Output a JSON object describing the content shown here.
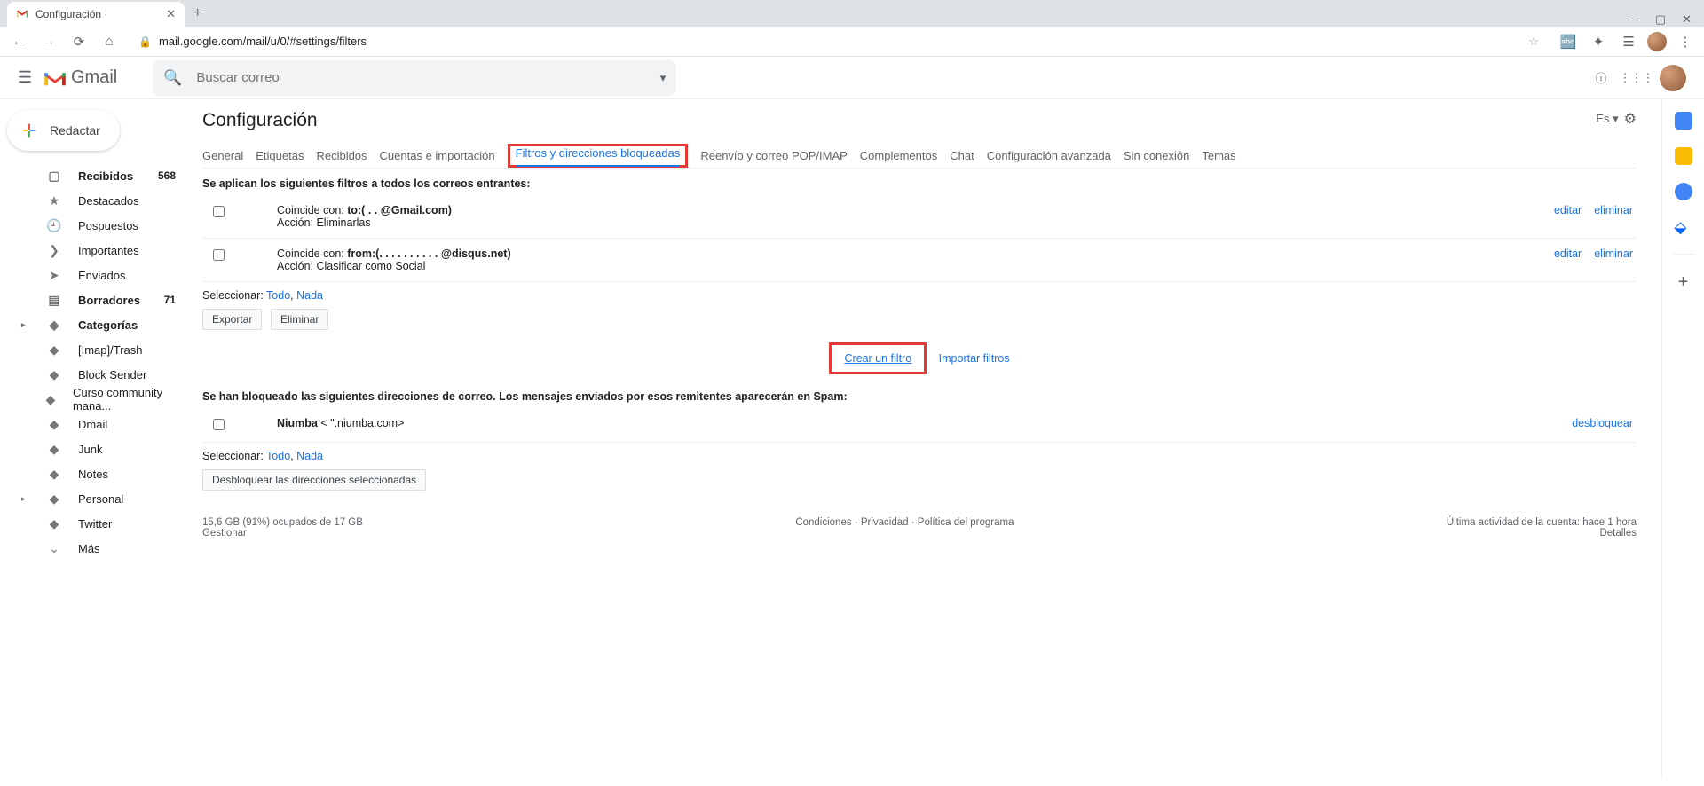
{
  "browser": {
    "tab_title": "Configuración ·",
    "url": "mail.google.com/mail/u/0/#settings/filters"
  },
  "header": {
    "logo_text": "Gmail",
    "search_placeholder": "Buscar correo"
  },
  "compose_label": "Redactar",
  "sidebar": {
    "items": [
      {
        "label": "Recibidos",
        "count": "568",
        "bold": true,
        "icon": "▢"
      },
      {
        "label": "Destacados",
        "icon": "★"
      },
      {
        "label": "Pospuestos",
        "icon": "🕘"
      },
      {
        "label": "Importantes",
        "icon": "❯"
      },
      {
        "label": "Enviados",
        "icon": "➤"
      },
      {
        "label": "Borradores",
        "count": "71",
        "bold": true,
        "icon": "▤"
      },
      {
        "label": "Categorías",
        "bold": true,
        "expandable": true,
        "icon": "◆"
      },
      {
        "label": "[Imap]/Trash",
        "icon": "◆"
      },
      {
        "label": "Block Sender",
        "icon": "◆"
      },
      {
        "label": "Curso community mana...",
        "icon": "◆"
      },
      {
        "label": "Dmail",
        "icon": "◆"
      },
      {
        "label": "Junk",
        "icon": "◆"
      },
      {
        "label": "Notes",
        "icon": "◆"
      },
      {
        "label": "Personal",
        "expandable": true,
        "icon": "◆"
      },
      {
        "label": "Twitter",
        "icon": "◆"
      },
      {
        "label": "Más",
        "icon": "⌄"
      }
    ]
  },
  "page": {
    "title": "Configuración",
    "lang": "Es",
    "tabs": [
      "General",
      "Etiquetas",
      "Recibidos",
      "Cuentas e importación",
      "Filtros y direcciones bloqueadas",
      "Reenvío y correo POP/IMAP",
      "Complementos",
      "Chat",
      "Configuración avanzada",
      "Sin conexión",
      "Temas"
    ],
    "active_tab_index": 4,
    "filters_heading": "Se aplican los siguientes filtros a todos los correos entrantes:",
    "filters": [
      {
        "match_label": "Coincide con:",
        "match_value": "to:(        . .    @Gmail.com)",
        "action_label": "Acción:",
        "action_value": "Eliminarlas"
      },
      {
        "match_label": "Coincide con:",
        "match_value": "from:(. . . . . . . . . .   @disqus.net)",
        "action_label": "Acción:",
        "action_value": "Clasificar como Social"
      }
    ],
    "edit_label": "editar",
    "delete_label": "eliminar",
    "select_label": "Seleccionar:",
    "select_all": "Todo",
    "select_none": "Nada",
    "export_btn": "Exportar",
    "delete_btn": "Eliminar",
    "create_filter": "Crear un filtro",
    "import_filters": "Importar filtros",
    "blocked_heading": "Se han bloqueado las siguientes direcciones de correo. Los mensajes enviados por esos remitentes aparecerán en Spam:",
    "blocked": [
      {
        "name": "Niumba",
        "addr": "<         \".niumba.com>"
      }
    ],
    "unblock_label": "desbloquear",
    "unblock_selected_btn": "Desbloquear las direcciones seleccionadas"
  },
  "footer": {
    "storage": "15,6 GB (91%) ocupados de 17 GB",
    "manage": "Gestionar",
    "terms": "Condiciones",
    "privacy": "Privacidad",
    "program": "Política del programa",
    "activity": "Última actividad de la cuenta: hace 1 hora",
    "details": "Detalles"
  }
}
